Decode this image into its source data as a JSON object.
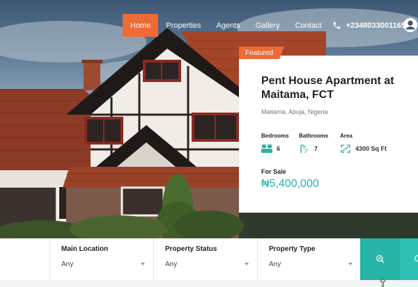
{
  "nav": {
    "items": [
      {
        "label": "Home",
        "active": true
      },
      {
        "label": "Properties",
        "active": false
      },
      {
        "label": "Agents",
        "active": false
      },
      {
        "label": "Gallery",
        "active": false
      },
      {
        "label": "Contact",
        "active": false
      }
    ],
    "phone": "+2348033001165"
  },
  "property": {
    "badge": "Featured",
    "title": "Pent House Apartment at Maitama, FCT",
    "location": "Maitama, Abuja, Nigeria",
    "bedrooms_label": "Bedrooms",
    "bedrooms": "6",
    "bathrooms_label": "Bathrooms",
    "bathrooms": "7",
    "area_label": "Area",
    "area": "4300 Sq Ft",
    "sale_label": "For Sale",
    "price": "₦5,400,000"
  },
  "search": {
    "fields": [
      {
        "label": "Main Location",
        "value": "Any"
      },
      {
        "label": "Property Status",
        "value": "Any"
      },
      {
        "label": "Property Type",
        "value": "Any"
      }
    ]
  },
  "colors": {
    "accent": "#ee6a36",
    "teal": "#27b3a6"
  },
  "icons": [
    "phone-icon",
    "user-icon",
    "bed-icon",
    "bath-icon",
    "area-icon",
    "search-icon",
    "cursor-icon"
  ]
}
